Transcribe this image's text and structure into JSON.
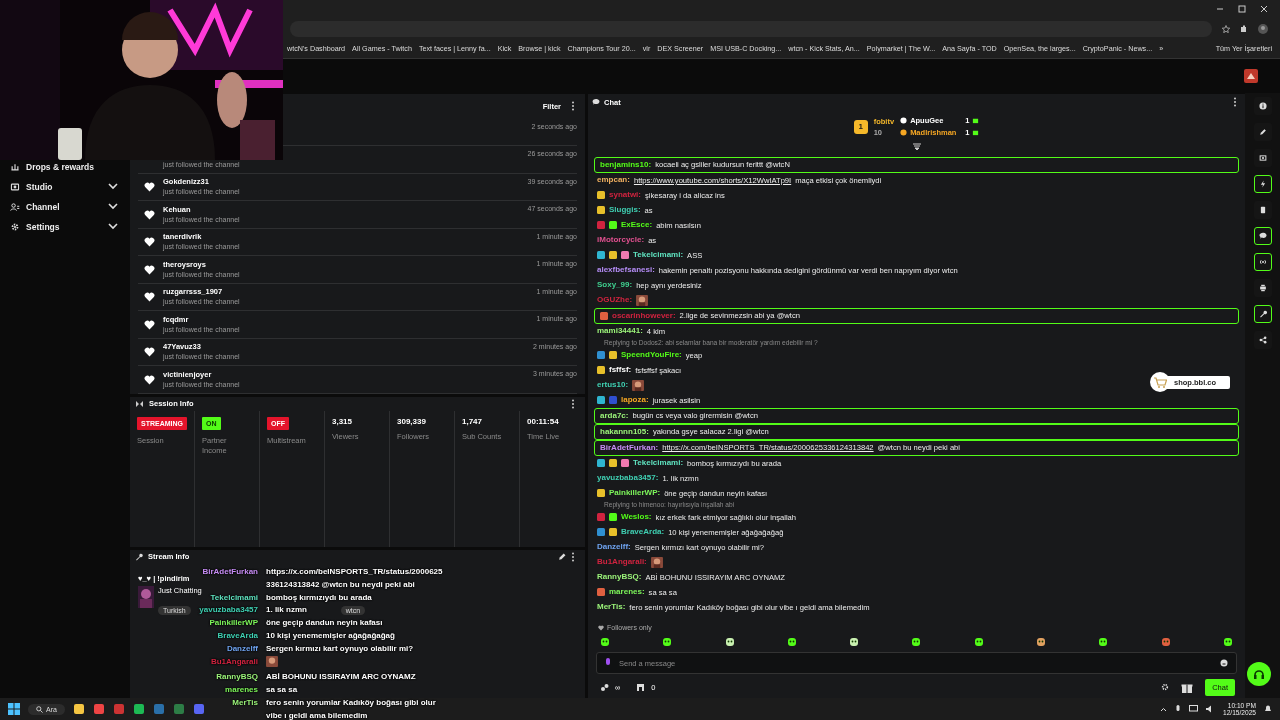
{
  "bookmarks": [
    "wtcN's Dashboard",
    "All Games - Twitch",
    "Text faces | Lenny fa...",
    "Kick",
    "Browse | kick",
    "Champions Tour 20...",
    "vlr",
    "DEX Screener",
    "MSI USB-C Docking...",
    "wtcn - Kick Stats, An...",
    "Polymarket | The W...",
    "Ana Sayfa - TOD",
    "OpenSea, the larges...",
    "CryptoPanic - News...",
    "»"
  ],
  "all_bookmarks": "Tüm Yer İşaretleri",
  "sidebar": {
    "items": [
      {
        "label": "Drops & rewards",
        "expandable": false
      },
      {
        "label": "Studio",
        "expandable": true
      },
      {
        "label": "Channel",
        "expandable": true
      },
      {
        "label": "Settings",
        "expandable": true
      }
    ]
  },
  "followers": {
    "filter": "Filter",
    "rows": [
      {
        "time": "2 seconds ago"
      },
      {
        "subtitle": "just followed the channel",
        "time": "26 seconds ago"
      },
      {
        "name": "Gokdenizz31",
        "subtitle": "just followed the channel",
        "time": "39 seconds ago"
      },
      {
        "name": "Kehuan",
        "subtitle": "just followed the channel",
        "time": "47 seconds ago"
      },
      {
        "name": "tanerdivrik",
        "subtitle": "just followed the channel",
        "time": "1 minute ago"
      },
      {
        "name": "theroysroys",
        "subtitle": "just followed the channel",
        "time": "1 minute ago"
      },
      {
        "name": "ruzgarrsss_1907",
        "subtitle": "just followed the channel",
        "time": "1 minute ago"
      },
      {
        "name": "fcqdmr",
        "subtitle": "just followed the channel",
        "time": "1 minute ago"
      },
      {
        "name": "47Yavuz33",
        "subtitle": "just followed the channel",
        "time": "2 minutes ago"
      },
      {
        "name": "victinienjoyer",
        "subtitle": "just followed the channel",
        "time": "3 minutes ago"
      }
    ]
  },
  "session_info": {
    "title": "Session Info",
    "stats": [
      {
        "kind": "badge",
        "value": "STREAMING",
        "color": "#e4142b",
        "label": "Session"
      },
      {
        "kind": "badge",
        "value": "ON",
        "color": "#53fc18",
        "label": "Partner Income"
      },
      {
        "kind": "badge",
        "value": "OFF",
        "color": "#e4142b",
        "label": "Multistream"
      },
      {
        "kind": "number",
        "value": "3,315",
        "label": "Viewers"
      },
      {
        "kind": "number",
        "value": "309,339",
        "label": "Followers"
      },
      {
        "kind": "number",
        "value": "1,747",
        "label": "Sub Counts"
      },
      {
        "kind": "number",
        "value": "00:11:54",
        "label": "Time Live"
      }
    ]
  },
  "stream_info": {
    "title": "Stream Info",
    "stream_title": "♥_♥ | !pindirim",
    "category": "Just Chatting",
    "tags": [
      "Turkish",
      "wtcn"
    ]
  },
  "stream_chat_overlay": [
    {
      "name": "BirAdetFurkan",
      "color": "#c78df5",
      "kind": "text",
      "text": "https://x.com/beINSPORTS_TR/status/2000625336124313842 @wtcn bu neydi peki abi"
    },
    {
      "name": "Tekelcimami",
      "color": "#5fe3c0",
      "kind": "text",
      "text": "bomboş kırmızıydı bu arada"
    },
    {
      "name": "yavuzbaba3457",
      "color": "#3fcfb2",
      "kind": "text",
      "text": "1. lik nzmn"
    },
    {
      "name": "PainkillerWP",
      "color": "#7df55a",
      "kind": "text",
      "text": "öne geçip dandun neyin kafası"
    },
    {
      "name": "BraveArda",
      "color": "#3fcfb2",
      "kind": "text",
      "text": "10 kişi yenememişler ağağağağağ"
    },
    {
      "name": "Danzelff",
      "color": "#6fa3f0",
      "kind": "text",
      "text": "Sergen kırmızı kart oynuyo olabilir mi?"
    },
    {
      "name": "Bu1Angarali",
      "color": "#d0233f",
      "kind": "emote"
    },
    {
      "name": "RannyBSQ",
      "color": "#9cf57a",
      "kind": "text",
      "text": "ABİ BOHUNU ISSIRAYIM ARC OYNAMZ"
    },
    {
      "name": "marenes",
      "color": "#7df55a",
      "kind": "text",
      "text": "sa sa sa"
    },
    {
      "name": "MerTis",
      "color": "#9cf57a",
      "kind": "text",
      "text": "fero senin yorumlar Kadıköy boğası gibi olur vibe ı geldi ama bilemedim"
    }
  ],
  "chat": {
    "title": "Chat",
    "leaderboard": {
      "rank": "1",
      "top": {
        "name": "fobitv",
        "count": "10"
      },
      "others": [
        {
          "name": "ApuuGee",
          "count": "1",
          "color": "#ffffff"
        },
        {
          "name": "Madlrishman",
          "count": "1",
          "color": "#f5a623"
        }
      ]
    },
    "messages": [
      {
        "name": "benjamins10:",
        "color": "#53fc18",
        "highlighted": true,
        "kind": "text",
        "text": "kocaeli aç gsliler kudursun ferittt @wtcN"
      },
      {
        "name": "empcan:",
        "color": "#f0b060",
        "highlighted": false,
        "kind": "link",
        "link": "https://www.youtube.com/shorts/X12WwIATp9I",
        "text": "maça etkisi çok önemliydi"
      },
      {
        "name": "synatwi:",
        "color": "#d0233f",
        "highlighted": false,
        "badges": [
          {
            "color": "#e8c02a"
          }
        ],
        "kind": "text",
        "text": "şikesaray i da alicaz ins"
      },
      {
        "name": "Sluggis:",
        "color": "#3fcfb2",
        "highlighted": false,
        "badges": [
          {
            "color": "#e8c02a"
          }
        ],
        "kind": "text",
        "text": "as"
      },
      {
        "name": "ExEsce:",
        "color": "#53fc18",
        "highlighted": false,
        "badges": [
          {
            "color": "#d0233f"
          },
          {
            "color": "#53fc18"
          }
        ],
        "kind": "text",
        "text": "abim nasılsın"
      },
      {
        "name": "iMotorcycle:",
        "color": "#e0508f",
        "highlighted": false,
        "kind": "text",
        "text": "as"
      },
      {
        "name": "Tekelcimami:",
        "color": "#5fe3c0",
        "highlighted": false,
        "badges": [
          {
            "color": "#2fb5d0"
          },
          {
            "color": "#e8c02a"
          },
          {
            "color": "#f07ab0"
          }
        ],
        "kind": "text",
        "text": "ASS"
      },
      {
        "name": "alexfbefsanesi:",
        "color": "#b48cf5",
        "highlighted": false,
        "kind": "text",
        "text": "hakemin penaltı pozisyonu hakkında dedigini gördünmü var verdi ben napıyım diyor wtcn"
      },
      {
        "name": "Soxy_99:",
        "color": "#3fcf8f",
        "highlighted": false,
        "kind": "text",
        "text": "hep aynı yerdesiniz"
      },
      {
        "name": "OGUZhe:",
        "color": "#d0233f",
        "highlighted": false,
        "kind": "emote"
      },
      {
        "name": "oscarinhowever:",
        "color": "#d0233f",
        "highlighted": true,
        "badges": [
          {
            "color": "#e06040"
          }
        ],
        "kind": "text",
        "text": "2.lige de sevinmezsin abi ya @wtcn"
      },
      {
        "name": "mami34441:",
        "color": "#9cf57a",
        "highlighted": false,
        "kind": "text",
        "text": "4 kim"
      },
      {
        "name": "SpeendYouFire:",
        "color": "#53fc18",
        "highlighted": false,
        "badges": [
          {
            "color": "#2f8fd0"
          },
          {
            "color": "#e8c02a"
          }
        ],
        "kind": "text",
        "text": "yeap",
        "reply": "Replying to Dodos2: abi selamlar bana bir moderatör yardım edebilir mi ?"
      },
      {
        "name": "fsffsf:",
        "color": "#ffffff",
        "highlighted": false,
        "badges": [
          {
            "color": "#e8c02a"
          }
        ],
        "kind": "text",
        "text": "fsfsffsf şakacı"
      },
      {
        "name": "ertus10:",
        "color": "#3fcfb2",
        "highlighted": false,
        "kind": "emote"
      },
      {
        "name": "lapoza:",
        "color": "#f5a623",
        "highlighted": false,
        "badges": [
          {
            "color": "#2fb5d0"
          },
          {
            "color": "#2f4fd0"
          }
        ],
        "kind": "text",
        "text": "jurasek asilsin"
      },
      {
        "name": "arda7c:",
        "color": "#9cf57a",
        "highlighted": true,
        "kind": "text",
        "text": "bugün cs veya valo girermisin @wtcn"
      },
      {
        "name": "hakannn105:",
        "color": "#9cf57a",
        "highlighted": true,
        "kind": "text",
        "text": "yakında gsye salacaz 2.ligi @wtcn"
      },
      {
        "name": "BirAdetFurkan:",
        "color": "#c78df5",
        "highlighted": true,
        "kind": "link",
        "link": "https://x.com/beINSPORTS_TR/status/2000625336124313842",
        "text": "@wtcn bu neydi peki abi"
      },
      {
        "name": "Tekelcimami:",
        "color": "#5fe3c0",
        "highlighted": false,
        "badges": [
          {
            "color": "#2fb5d0"
          },
          {
            "color": "#e8c02a"
          },
          {
            "color": "#f07ab0"
          }
        ],
        "kind": "text",
        "text": "bomboş kırmızıydı bu arada"
      },
      {
        "name": "yavuzbaba3457:",
        "color": "#3fcfb2",
        "highlighted": false,
        "kind": "text",
        "text": "1. lik nzmn"
      },
      {
        "name": "PainkillerWP:",
        "color": "#7df55a",
        "highlighted": false,
        "badges": [
          {
            "color": "#e8c02a"
          }
        ],
        "kind": "text",
        "text": "öne geçip dandun neyin kafası"
      },
      {
        "name": "Weslos:",
        "color": "#53fc18",
        "highlighted": false,
        "badges": [
          {
            "color": "#d0233f"
          },
          {
            "color": "#53fc18"
          }
        ],
        "kind": "text",
        "text": "kız erkek fark etmiyor sağlıklı olur inşallah",
        "reply": "Replying to himenoo: hayırlısıyla inşallah abi"
      },
      {
        "name": "BraveArda:",
        "color": "#3fcfb2",
        "highlighted": false,
        "badges": [
          {
            "color": "#2f8fd0"
          },
          {
            "color": "#e8c02a"
          }
        ],
        "kind": "text",
        "text": "10 kişi yenememişler ağağağağağ"
      },
      {
        "name": "Danzelff:",
        "color": "#6fa3f0",
        "highlighted": false,
        "kind": "text",
        "text": "Sergen kırmızı kart oynuyo olabilir mi?"
      },
      {
        "name": "Bu1Angarali:",
        "color": "#d0233f",
        "highlighted": false,
        "kind": "emote"
      },
      {
        "name": "RannyBSQ:",
        "color": "#9cf57a",
        "highlighted": false,
        "kind": "text",
        "text": "ABİ BOHUNU ISSIRAYIM ARC OYNAMZ"
      },
      {
        "name": "marenes:",
        "color": "#7df55a",
        "highlighted": false,
        "badges": [
          {
            "color": "#e06040"
          }
        ],
        "kind": "text",
        "text": "sa sa sa"
      },
      {
        "name": "MerTis:",
        "color": "#9cf57a",
        "highlighted": false,
        "kind": "text",
        "text": "fero senin yorumlar Kadıköy boğası gibi olur vibe ı geldi ama bilemedim"
      }
    ],
    "followers_only": "Followers only",
    "input": {
      "placeholder": "Send a message"
    },
    "points": "∞",
    "count": "0",
    "send": "Chat"
  },
  "rail": [
    {
      "on": false
    },
    {
      "on": false
    },
    {
      "on": false
    },
    {
      "on": true
    },
    {
      "on": false
    },
    {
      "on": true
    },
    {
      "on": true
    },
    {
      "on": false
    },
    {
      "on": true
    },
    {
      "on": false
    }
  ],
  "shop": "shop.bbl.co",
  "taskbar": {
    "search": "Ara",
    "time": "10:10 PM",
    "date": "12/15/2025"
  }
}
